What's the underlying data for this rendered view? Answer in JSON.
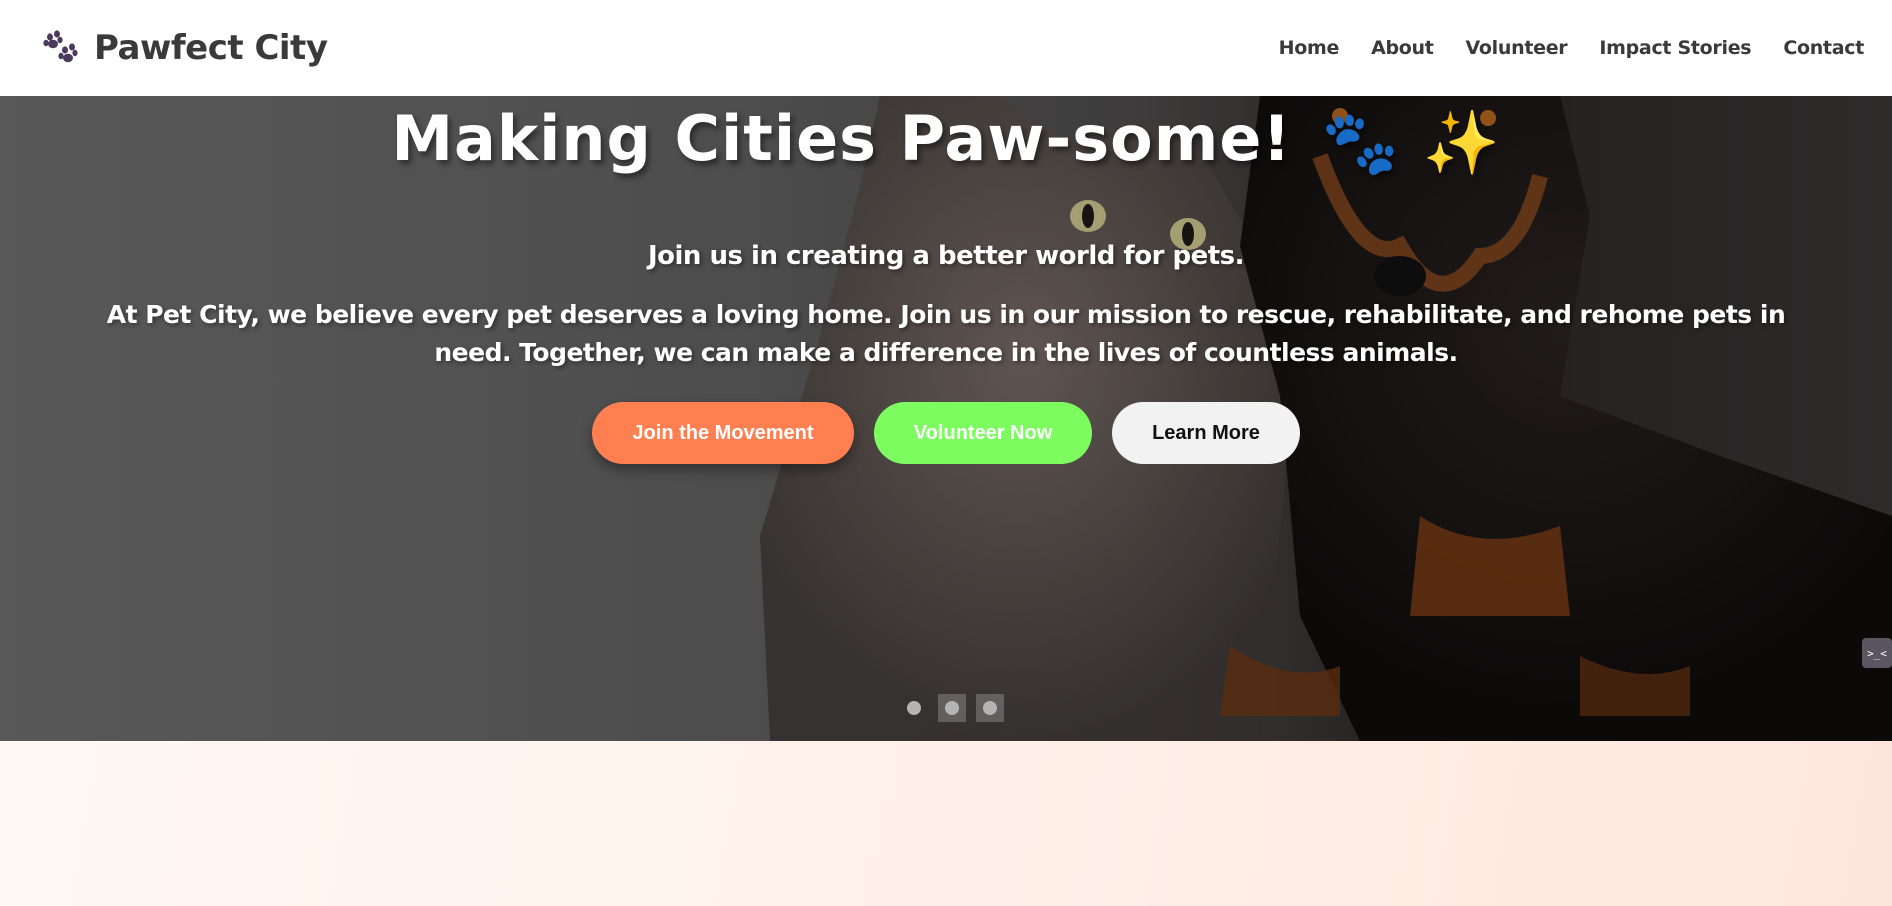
{
  "header": {
    "brand": "Pawfect City",
    "brand_icon": "paw-print-icon",
    "nav": [
      {
        "label": "Home"
      },
      {
        "label": "About"
      },
      {
        "label": "Volunteer"
      },
      {
        "label": "Impact Stories"
      },
      {
        "label": "Contact"
      }
    ]
  },
  "hero": {
    "title": "Making Cities Paw-some!",
    "title_emoji": "🐾 ✨",
    "subtitle": "Join us in creating a better world for pets.",
    "description": "At Pet City, we believe every pet deserves a loving home. Join us in our mission to rescue, rehabilitate, and rehome pets in need. Together, we can make a difference in the lives of countless animals.",
    "buttons": {
      "primary": "Join the Movement",
      "secondary": "Volunteer Now",
      "tertiary": "Learn More"
    },
    "slides": {
      "count": 3,
      "active": 1
    }
  },
  "side_tab": {
    "label": ">_<"
  },
  "colors": {
    "primary": "#ff7f50",
    "secondary": "#7cfc5f",
    "tertiary": "#f2f2f2",
    "brand_text": "#3a3a3a",
    "paw_icon": "#4a3a5e"
  }
}
